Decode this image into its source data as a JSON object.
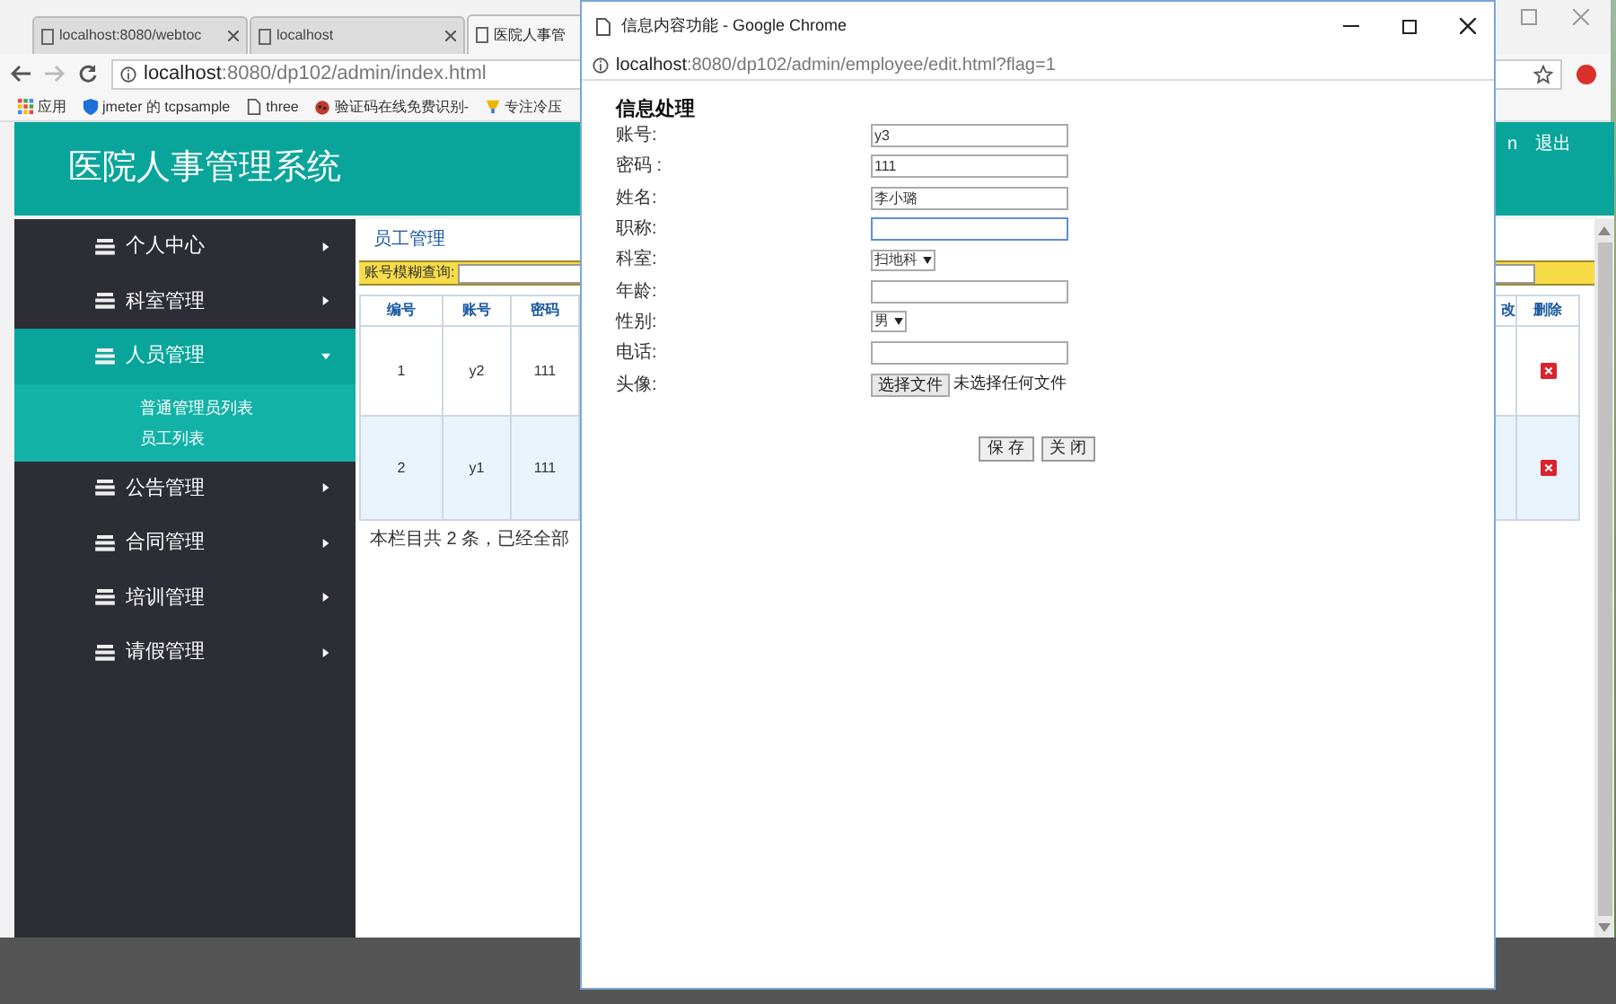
{
  "browser": {
    "tabs": [
      {
        "title": "localhost:8080/webtoc",
        "selected": false
      },
      {
        "title": "localhost",
        "selected": false
      },
      {
        "title": "医院人事管",
        "selected": true
      }
    ],
    "address": {
      "host": "localhost",
      "path": ":8080/dp102/admin/index.html"
    },
    "bookmarks": [
      {
        "label": "应用",
        "kind": "apps"
      },
      {
        "label": "jmeter 的 tcpsample",
        "kind": "shield"
      },
      {
        "label": "three",
        "kind": "page"
      },
      {
        "label": "验证码在线免费识别-",
        "kind": "bug"
      },
      {
        "label": "专注冷压",
        "kind": "trophy"
      }
    ]
  },
  "app": {
    "title": "医院人事管理系统",
    "user": "n",
    "logout": "退出",
    "sidebar": [
      {
        "label": "个人中心",
        "expanded": false
      },
      {
        "label": "科室管理",
        "expanded": false
      },
      {
        "label": "人员管理",
        "expanded": true,
        "children": [
          {
            "label": "普通管理员列表"
          },
          {
            "label": "员工列表"
          }
        ]
      },
      {
        "label": "公告管理",
        "expanded": false
      },
      {
        "label": "合同管理",
        "expanded": false
      },
      {
        "label": "培训管理",
        "expanded": false
      },
      {
        "label": "请假管理",
        "expanded": false
      }
    ],
    "breadcrumb": "员工管理",
    "search_label": "账号模糊查询:",
    "table": {
      "columns": [
        "编号",
        "账号",
        "密码",
        "改",
        "删除"
      ],
      "rows": [
        {
          "cells": [
            "1",
            "y2",
            "111"
          ]
        },
        {
          "cells": [
            "2",
            "y1",
            "111"
          ]
        }
      ]
    },
    "summary": "本栏目共 2 条，已经全部"
  },
  "popup": {
    "title": "信息内容功能 - Google Chrome",
    "address": {
      "host": "localhost",
      "path": ":8080/dp102/admin/employee/edit.html?flag=1"
    },
    "heading": "信息处理",
    "fields": [
      {
        "label": "账号:",
        "kind": "text",
        "value": "y3",
        "focused": false
      },
      {
        "label": "密码 :",
        "kind": "text",
        "value": "111",
        "focused": false
      },
      {
        "label": "姓名:",
        "kind": "text",
        "value": "李小璐",
        "focused": false
      },
      {
        "label": "职称:",
        "kind": "text",
        "focused": true
      },
      {
        "label": "科室:",
        "kind": "select",
        "value": "扫地科"
      },
      {
        "label": "年龄:",
        "kind": "text",
        "focused": false
      },
      {
        "label": "性别:",
        "kind": "select",
        "value": "男"
      },
      {
        "label": "电话:",
        "kind": "text",
        "focused": false
      },
      {
        "label": "头像:",
        "kind": "file",
        "button": "选择文件",
        "value": "未选择任何文件"
      }
    ],
    "buttons": [
      "保 存",
      "关 闭"
    ]
  }
}
